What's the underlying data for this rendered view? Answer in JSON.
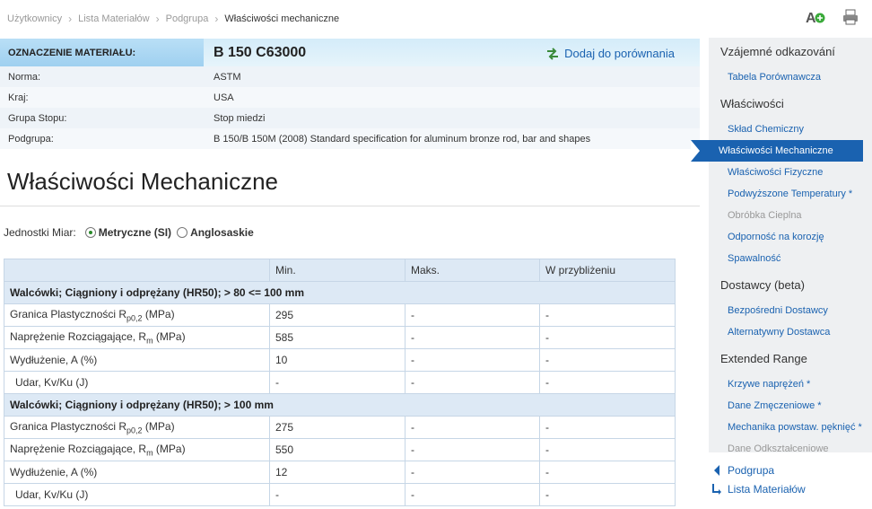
{
  "breadcrumb": [
    "Użytkownicy",
    "Lista Materiałów",
    "Podgrupa",
    "Właściwości mechaniczne"
  ],
  "material": {
    "header_label": "OZNACZENIE MATERIAŁU:",
    "code": "B 150 C63000",
    "compare_label": "Dodaj do porównania",
    "rows": [
      {
        "label": "Norma:",
        "value": "ASTM"
      },
      {
        "label": "Kraj:",
        "value": "USA"
      },
      {
        "label": "Grupa Stopu:",
        "value": "Stop miedzi"
      },
      {
        "label": "Podgrupa:",
        "value": "B 150/B 150M (2008) Standard specification for aluminum bronze rod, bar and shapes"
      }
    ]
  },
  "page_title": "Właściwości Mechaniczne",
  "units": {
    "label": "Jednostki Miar:",
    "opt1": "Metryczne (SI)",
    "opt2": "Anglosaskie",
    "selected": "Metryczne (SI)"
  },
  "table": {
    "headers": [
      "",
      "Min.",
      "Maks.",
      "W przybliżeniu"
    ],
    "groups": [
      {
        "title": "Walcówki; Ciągniony i odprężany (HR50); > 80 <= 100 mm",
        "rows": [
          {
            "name": "Granica Plastyczności R",
            "sub": "p0,2",
            "unit": " (MPa)",
            "min": "295",
            "max": "-",
            "approx": "-"
          },
          {
            "name": "Naprężenie Rozciągające, R",
            "sub": "m",
            "unit": " (MPa)",
            "min": "585",
            "max": "-",
            "approx": "-"
          },
          {
            "name": "Wydłużenie, A (%)",
            "sub": "",
            "unit": "",
            "min": "10",
            "max": "-",
            "approx": "-"
          },
          {
            "name": "Udar, Kv/Ku (J)",
            "sub": "",
            "unit": "",
            "min": "-",
            "max": "-",
            "approx": "-"
          }
        ]
      },
      {
        "title": "Walcówki; Ciągniony i odprężany (HR50); > 100 mm",
        "rows": [
          {
            "name": "Granica Plastyczności R",
            "sub": "p0,2",
            "unit": " (MPa)",
            "min": "275",
            "max": "-",
            "approx": "-"
          },
          {
            "name": "Naprężenie Rozciągające, R",
            "sub": "m",
            "unit": " (MPa)",
            "min": "550",
            "max": "-",
            "approx": "-"
          },
          {
            "name": "Wydłużenie, A (%)",
            "sub": "",
            "unit": "",
            "min": "12",
            "max": "-",
            "approx": "-"
          },
          {
            "name": "Udar, Kv/Ku (J)",
            "sub": "",
            "unit": "",
            "min": "-",
            "max": "-",
            "approx": "-"
          }
        ]
      }
    ]
  },
  "sidebar": {
    "sections": [
      {
        "title": "Vzájemné odkazování",
        "items": [
          {
            "label": "Tabela Porównawcza",
            "state": "link"
          }
        ]
      },
      {
        "title": "Właściwości",
        "items": [
          {
            "label": "Skład Chemiczny",
            "state": "link"
          },
          {
            "label": "Właściwości Mechaniczne",
            "state": "active"
          },
          {
            "label": "Właściwości Fizyczne",
            "state": "link"
          },
          {
            "label": "Podwyższone Temperatury *",
            "state": "link"
          },
          {
            "label": "Obróbka Cieplna",
            "state": "disabled"
          },
          {
            "label": "Odporność na korozję",
            "state": "link"
          },
          {
            "label": "Spawalność",
            "state": "link"
          }
        ]
      },
      {
        "title": "Dostawcy (beta)",
        "items": [
          {
            "label": "Bezpośredni Dostawcy",
            "state": "link"
          },
          {
            "label": "Alternatywny Dostawca",
            "state": "link"
          }
        ]
      },
      {
        "title": "Extended Range",
        "items": [
          {
            "label": "Krzywe naprężeń *",
            "state": "link"
          },
          {
            "label": "Dane Zmęczeniowe *",
            "state": "link"
          },
          {
            "label": "Mechanika powstaw. pęknięć *",
            "state": "link"
          },
          {
            "label": "Dane Odkształceniowe",
            "state": "disabled"
          }
        ]
      }
    ]
  },
  "bottom_links": {
    "back": "Podgrupa",
    "up": "Lista Materiałów"
  },
  "colors": {
    "accent": "#1a62b0",
    "header_blue": "#b9dff6",
    "row_blue": "#dde9f5"
  }
}
